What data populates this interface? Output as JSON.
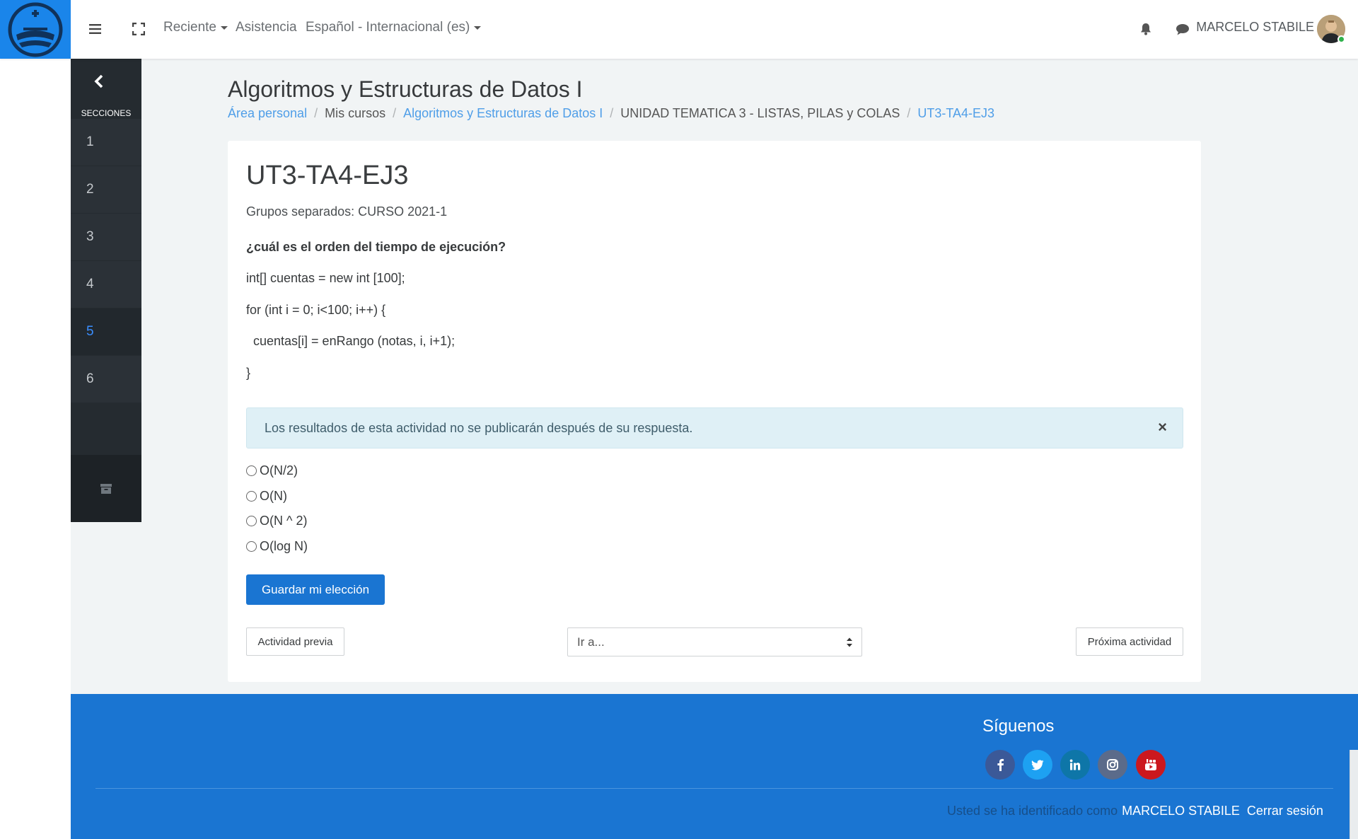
{
  "navbar": {
    "menu_icon": "hamburger-icon",
    "fullscreen_icon": "expand-icon",
    "recent_label": "Reciente",
    "help_label": "Asistencia",
    "language_label": "Español - Internacional (es)",
    "notifications_icon": "bell-icon",
    "messages_icon": "chat-icon",
    "user_name": "MARCELO STABILE"
  },
  "drawer": {
    "title": "SECCIONES",
    "sections": [
      "1",
      "2",
      "3",
      "4",
      "5",
      "6"
    ],
    "active_section": "5",
    "bottom_icon": "archive-icon"
  },
  "page": {
    "heading": "Algoritmos y Estructuras de Datos I",
    "breadcrumb": [
      {
        "label": "Área personal",
        "link": true
      },
      {
        "label": "Mis cursos",
        "link": false
      },
      {
        "label": "Algoritmos y Estructuras de Datos I",
        "link": true
      },
      {
        "label": "UNIDAD TEMATICA 3 - LISTAS, PILAS y COLAS",
        "link": false
      },
      {
        "label": "UT3-TA4-EJ3",
        "link": true
      }
    ]
  },
  "activity": {
    "title": "UT3-TA4-EJ3",
    "group_line": "Grupos separados: CURSO 2021-1",
    "question": "¿cuál es el orden del tiempo de ejecución?",
    "code": [
      "int[] cuentas = new int [100];",
      "for (int i = 0; i<100; i++) {",
      "  cuentas[i] = enRango (notas, i, i+1);",
      "}"
    ],
    "alert_text": "Los resultados de esta actividad no se publicarán después de su respuesta.",
    "alert_close": "×",
    "options": [
      "O(N/2)",
      "O(N)",
      "O(N ^ 2)",
      "O(log N)"
    ],
    "save_label": "Guardar mi elección",
    "prev_label": "Actividad previa",
    "jump_placeholder": "Ir a...",
    "next_label": "Próxima actividad"
  },
  "footer": {
    "follow_title": "Síguenos",
    "social": [
      {
        "icon": "facebook-icon",
        "glyph": "f",
        "color": "#3b5998"
      },
      {
        "icon": "twitter-icon",
        "glyph": "t",
        "color": "#1da1f2"
      },
      {
        "icon": "linkedin-icon",
        "glyph": "in",
        "color": "#0e76a8"
      },
      {
        "icon": "instagram-icon",
        "glyph": "◎",
        "color": "#5b6b8a"
      },
      {
        "icon": "youtube-icon",
        "glyph": "▶",
        "color": "#cc181e"
      }
    ],
    "logged_in_text": "Usted se ha identificado como",
    "user_link": "MARCELO STABILE",
    "logout_label": "Cerrar sesión"
  },
  "colors": {
    "brand_blue": "#1a85ea",
    "primary_button": "#1a75d2",
    "drawer_bg": "#252b30",
    "active_section": "#3a8eff",
    "alert_bg": "#dff0f6"
  }
}
